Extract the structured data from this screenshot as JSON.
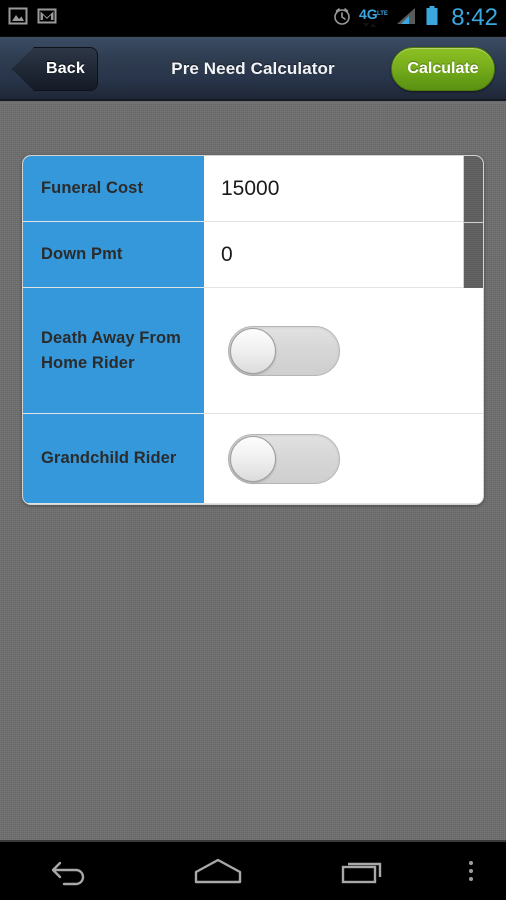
{
  "status_bar": {
    "icons": [
      "screenshot-image-icon",
      "gmail-icon",
      "alarm-clock-icon",
      "network-4g-lte-icon",
      "signal-bars-icon",
      "battery-icon"
    ],
    "network_label": "4G",
    "network_sub_label": "LTE",
    "clock": "8:42"
  },
  "action_bar": {
    "back_label": "Back",
    "title": "Pre Need Calculator",
    "calculate_label": "Calculate",
    "accent_green": "#7bb01d",
    "bar_color": "#2f3d51"
  },
  "form": {
    "label_color": "#3498db",
    "rows": [
      {
        "label": "Funeral Cost",
        "type": "text",
        "value": "15000"
      },
      {
        "label": "Down Pmt",
        "type": "text",
        "value": "0"
      },
      {
        "label": "Death Away From Home Rider",
        "type": "toggle",
        "state": "off"
      },
      {
        "label": "Grandchild Rider",
        "type": "toggle",
        "state": "off"
      }
    ]
  },
  "nav_bar": {
    "buttons": [
      "back-nav-icon",
      "home-nav-icon",
      "recent-apps-nav-icon",
      "overflow-menu-icon"
    ]
  }
}
